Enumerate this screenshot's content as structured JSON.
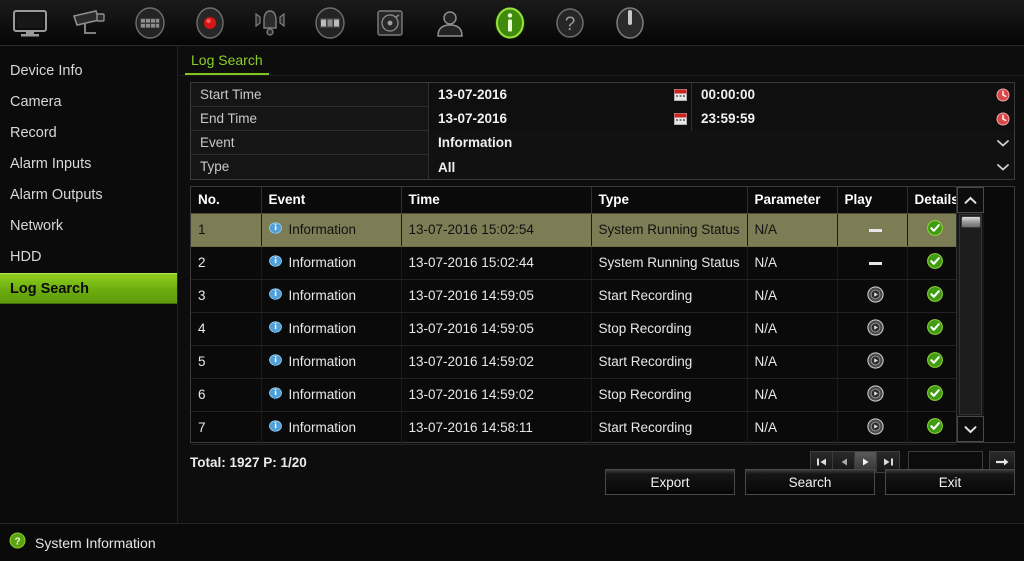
{
  "toolbar": {
    "items": [
      {
        "icon": "monitor-icon",
        "label": "Live View",
        "active": false
      },
      {
        "icon": "camera-icon",
        "label": "Camera",
        "active": false
      },
      {
        "icon": "playback-icon",
        "label": "Playback",
        "active": false
      },
      {
        "icon": "record-icon",
        "label": "Record",
        "active": false
      },
      {
        "icon": "alarm-icon",
        "label": "Alarm",
        "active": false
      },
      {
        "icon": "network-icon",
        "label": "Network",
        "active": false
      },
      {
        "icon": "hdd-icon",
        "label": "HDD",
        "active": false
      },
      {
        "icon": "user-icon",
        "label": "User",
        "active": false
      },
      {
        "icon": "info-icon",
        "label": "System Information",
        "active": true
      },
      {
        "icon": "help-icon",
        "label": "Help",
        "active": false
      },
      {
        "icon": "power-icon",
        "label": "Shutdown",
        "active": false
      }
    ]
  },
  "sidebar": {
    "items": [
      {
        "label": "Device Info",
        "active": false
      },
      {
        "label": "Camera",
        "active": false
      },
      {
        "label": "Record",
        "active": false
      },
      {
        "label": "Alarm Inputs",
        "active": false
      },
      {
        "label": "Alarm Outputs",
        "active": false
      },
      {
        "label": "Network",
        "active": false
      },
      {
        "label": "HDD",
        "active": false
      },
      {
        "label": "Log Search",
        "active": true
      }
    ]
  },
  "tab": {
    "label": "Log Search"
  },
  "form": {
    "start_time": {
      "label": "Start Time",
      "date": "13-07-2016",
      "time": "00:00:00",
      "date_icon": "calendar-icon",
      "time_icon": "clock-icon"
    },
    "end_time": {
      "label": "End Time",
      "date": "13-07-2016",
      "time": "23:59:59",
      "date_icon": "calendar-icon",
      "time_icon": "clock-icon"
    },
    "event": {
      "label": "Event",
      "value": "Information",
      "icon": "chevron-down-icon"
    },
    "type": {
      "label": "Type",
      "value": "All",
      "icon": "chevron-down-icon"
    }
  },
  "table": {
    "columns": [
      "No.",
      "Event",
      "Time",
      "Type",
      "Parameter",
      "Play",
      "Details"
    ],
    "rows": [
      {
        "no": "1",
        "event": "Information",
        "event_icon": "info-bubble-icon",
        "time": "13-07-2016 15:02:54",
        "type": "System Running Status",
        "parameter": "N/A",
        "play": "none",
        "details": "check-icon",
        "selected": true
      },
      {
        "no": "2",
        "event": "Information",
        "event_icon": "info-bubble-icon",
        "time": "13-07-2016 15:02:44",
        "type": "System Running Status",
        "parameter": "N/A",
        "play": "none",
        "details": "check-icon",
        "selected": false
      },
      {
        "no": "3",
        "event": "Information",
        "event_icon": "info-bubble-icon",
        "time": "13-07-2016 14:59:05",
        "type": "Start Recording",
        "parameter": "N/A",
        "play": "play-icon",
        "details": "check-icon",
        "selected": false
      },
      {
        "no": "4",
        "event": "Information",
        "event_icon": "info-bubble-icon",
        "time": "13-07-2016 14:59:05",
        "type": "Stop Recording",
        "parameter": "N/A",
        "play": "play-icon",
        "details": "check-icon",
        "selected": false
      },
      {
        "no": "5",
        "event": "Information",
        "event_icon": "info-bubble-icon",
        "time": "13-07-2016 14:59:02",
        "type": "Start Recording",
        "parameter": "N/A",
        "play": "play-icon",
        "details": "check-icon",
        "selected": false
      },
      {
        "no": "6",
        "event": "Information",
        "event_icon": "info-bubble-icon",
        "time": "13-07-2016 14:59:02",
        "type": "Stop Recording",
        "parameter": "N/A",
        "play": "play-icon",
        "details": "check-icon",
        "selected": false
      },
      {
        "no": "7",
        "event": "Information",
        "event_icon": "info-bubble-icon",
        "time": "13-07-2016 14:58:11",
        "type": "Start Recording",
        "parameter": "N/A",
        "play": "play-icon",
        "details": "check-icon",
        "selected": false
      }
    ]
  },
  "footer": {
    "totals": "Total: 1927  P: 1/20",
    "pager": {
      "first": "first-page-icon",
      "prev": "prev-page-icon",
      "next": "next-page-icon",
      "last": "last-page-icon",
      "page_input_value": "",
      "page_input_placeholder": "",
      "go": "go-arrow-icon"
    },
    "buttons": {
      "export": "Export",
      "search": "Search",
      "exit": "Exit"
    }
  },
  "statusbar": {
    "icon": "info-icon",
    "text": "System Information"
  },
  "colors": {
    "accent_green": "#8ad02a",
    "selection_olive": "#7d7d55",
    "panel_bg": "#0d0d0d",
    "status_ok": "#4caf1d"
  }
}
